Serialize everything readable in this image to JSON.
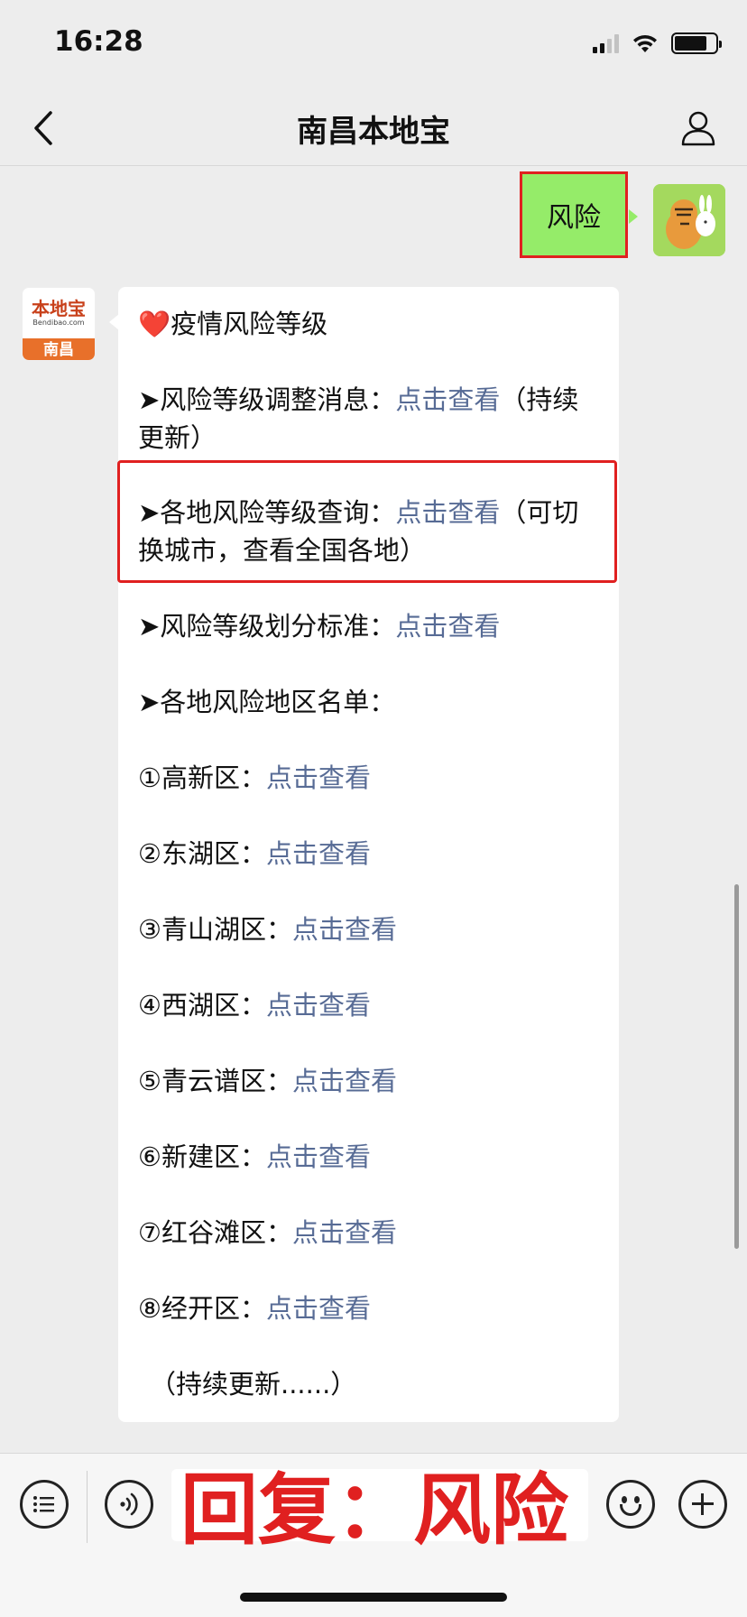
{
  "status_bar": {
    "time": "16:28"
  },
  "nav": {
    "title": "南昌本地宝"
  },
  "sent_message": {
    "text": "风险"
  },
  "bot_avatar": {
    "logo_text": "本地宝",
    "logo_sub": "Bendibao.com",
    "city": "南昌"
  },
  "message": {
    "heading": "❤️疫情风险等级",
    "item1_label": "➤风险等级调整消息：",
    "item1_link": "点击查看",
    "item1_suffix": "（持续更新）",
    "item2_label": "➤各地风险等级查询：",
    "item2_link": "点击查看",
    "item2_suffix": "（可切换城市，查看全国各地）",
    "item3_label": "➤风险等级划分标准：",
    "item3_link": "点击查看",
    "list_heading": "➤各地风险地区名单：",
    "districts": [
      {
        "label": "①高新区：",
        "link": "点击查看"
      },
      {
        "label": "②东湖区：",
        "link": "点击查看"
      },
      {
        "label": "③青山湖区：",
        "link": "点击查看"
      },
      {
        "label": "④西湖区：",
        "link": "点击查看"
      },
      {
        "label": "⑤青云谱区：",
        "link": "点击查看"
      },
      {
        "label": "⑥新建区：",
        "link": "点击查看"
      },
      {
        "label": "⑦红谷滩区：",
        "link": "点击查看"
      },
      {
        "label": "⑧经开区：",
        "link": "点击查看"
      }
    ],
    "footer": "（持续更新......）"
  },
  "overlay": {
    "reply_text": "回复：风险"
  },
  "colors": {
    "link": "#576b95",
    "sent_bubble": "#95ec69",
    "highlight": "#e02020"
  }
}
